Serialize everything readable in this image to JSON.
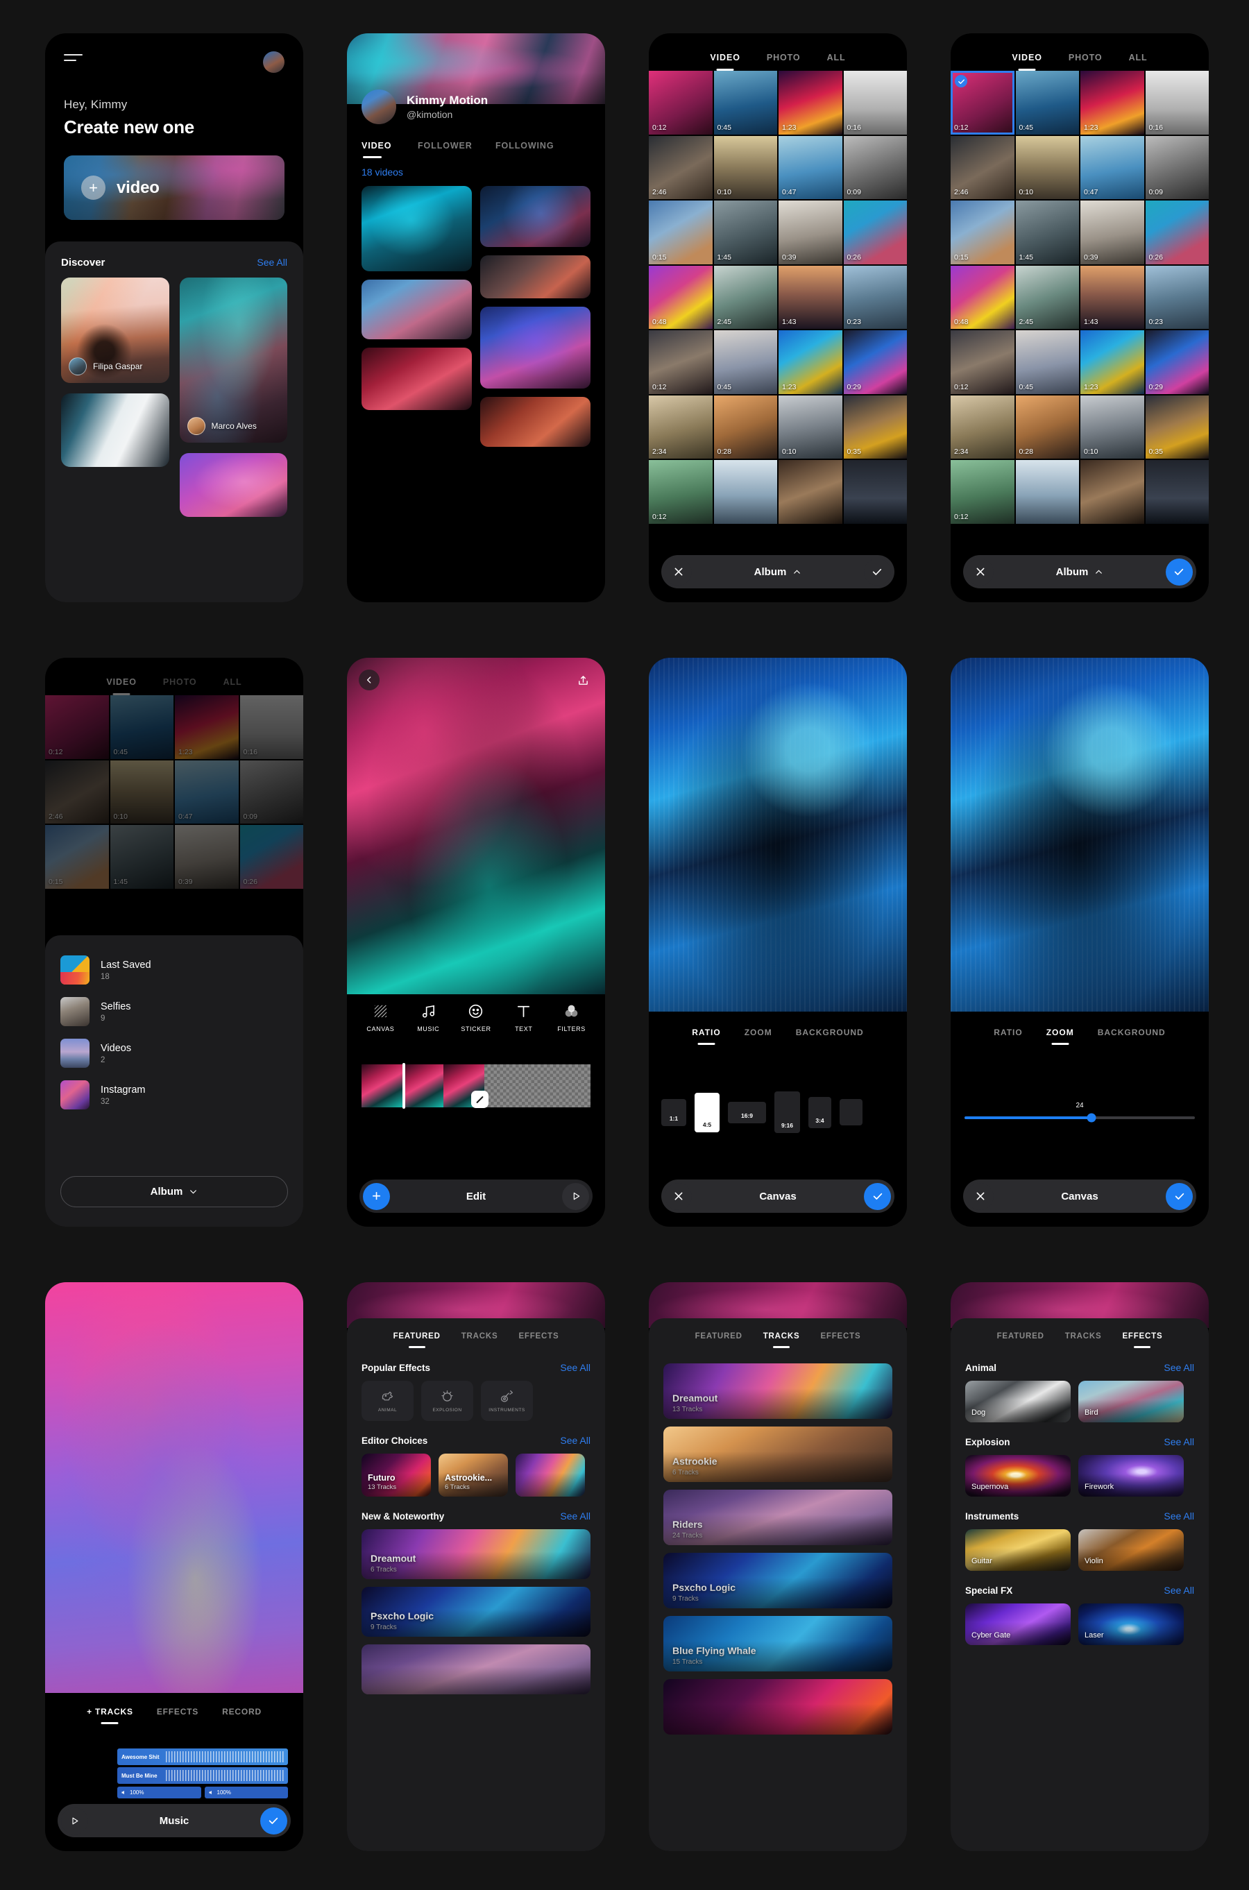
{
  "home": {
    "greeting": "Hey, Kimmy",
    "title": "Create new one",
    "hero_label": "video",
    "discover": {
      "title": "Discover",
      "see_all": "See All"
    },
    "discover_cards": [
      {
        "author": "Filipa Gaspar"
      },
      {
        "author": "Marco Alves"
      }
    ]
  },
  "profile": {
    "name": "Kimmy Motion",
    "handle": "@kimotion",
    "tabs": [
      {
        "label": "VIDEO",
        "active": true
      },
      {
        "label": "FOLLOWER",
        "active": false
      },
      {
        "label": "FOLLOWING",
        "active": false
      }
    ],
    "video_count": "18 videos"
  },
  "gallery": {
    "tabs": [
      {
        "label": "VIDEO",
        "active": true
      },
      {
        "label": "PHOTO",
        "active": false
      },
      {
        "label": "ALL",
        "active": false
      }
    ],
    "durations": [
      "0:12",
      "0:45",
      "1:23",
      "0:16",
      "2:46",
      "0:10",
      "0:47",
      "0:09",
      "0:15",
      "1:45",
      "0:39",
      "0:26",
      "0:48",
      "2:45",
      "1:43",
      "0:23",
      "0:12",
      "0:45",
      "1:23",
      "0:29",
      "2:34",
      "0:28",
      "0:10",
      "0:35",
      "0:12",
      "",
      "",
      ""
    ],
    "bottom_bar": {
      "close_icon": "close-icon",
      "label": "Album",
      "chevron": "chevron-up-icon",
      "confirm_icon": "check-icon"
    }
  },
  "albums": {
    "tabs": [
      {
        "label": "VIDEO",
        "active": true
      },
      {
        "label": "PHOTO",
        "active": false
      },
      {
        "label": "ALL",
        "active": false
      }
    ],
    "items": [
      {
        "name": "Last Saved",
        "count": "18"
      },
      {
        "name": "Selfies",
        "count": "9"
      },
      {
        "name": "Videos",
        "count": "2"
      },
      {
        "name": "Instagram",
        "count": "32"
      }
    ],
    "button_label": "Album"
  },
  "editor": {
    "tools": [
      {
        "label": "CANVAS",
        "icon": "canvas-icon"
      },
      {
        "label": "MUSIC",
        "icon": "music-note-icon"
      },
      {
        "label": "STICKER",
        "icon": "smiley-icon"
      },
      {
        "label": "TEXT",
        "icon": "text-t-icon"
      },
      {
        "label": "FILTERS",
        "icon": "filters-circles-icon"
      }
    ],
    "bottom_bar": {
      "add_icon": "plus-icon",
      "label": "Edit",
      "play_icon": "play-icon"
    }
  },
  "canvas_ratio": {
    "tabs": [
      {
        "label": "RATIO",
        "active": true
      },
      {
        "label": "ZOOM",
        "active": false
      },
      {
        "label": "BACKGROUND",
        "active": false
      }
    ],
    "ratios": [
      {
        "label": "1:1",
        "selected": false
      },
      {
        "label": "4:5",
        "selected": true
      },
      {
        "label": "16:9",
        "selected": false
      },
      {
        "label": "9:16",
        "selected": false
      },
      {
        "label": "3:4",
        "selected": false
      }
    ],
    "bottom_bar": {
      "label": "Canvas"
    }
  },
  "canvas_zoom": {
    "tabs": [
      {
        "label": "RATIO",
        "active": false
      },
      {
        "label": "ZOOM",
        "active": true
      },
      {
        "label": "BACKGROUND",
        "active": false
      }
    ],
    "zoom_value": "24",
    "bottom_bar": {
      "label": "Canvas"
    }
  },
  "music": {
    "tabs": [
      {
        "label": "+ TRACKS",
        "active": true
      },
      {
        "label": "EFFECTS",
        "active": false
      },
      {
        "label": "RECORD",
        "active": false
      }
    ],
    "clips": [
      {
        "title": "Awesome Shit"
      },
      {
        "title": "Must Be Mine"
      }
    ],
    "volumes": [
      "100%",
      "100%"
    ],
    "bottom_bar": {
      "label": "Music"
    }
  },
  "store_featured": {
    "tabs": [
      {
        "label": "FEATURED",
        "active": true
      },
      {
        "label": "TRACKS",
        "active": false
      },
      {
        "label": "EFFECTS",
        "active": false
      }
    ],
    "sections": [
      {
        "title": "Popular Effects",
        "see_all": "See All",
        "chips": [
          {
            "label": "ANIMAL",
            "icon": "animal-icon"
          },
          {
            "label": "EXPLOSION",
            "icon": "explosion-icon"
          },
          {
            "label": "INSTRUMENTS",
            "icon": "instrument-icon"
          }
        ]
      },
      {
        "title": "Editor Choices",
        "see_all": "See All",
        "cards": [
          {
            "title": "Futuro",
            "sub": "13 Tracks"
          },
          {
            "title": "Astrookie...",
            "sub": "6 Tracks"
          }
        ]
      },
      {
        "title": "New & Noteworthy",
        "see_all": "See All",
        "cards": [
          {
            "title": "Dreamout",
            "sub": "6 Tracks"
          },
          {
            "title": "Psxcho Logic",
            "sub": "9 Tracks"
          }
        ]
      }
    ]
  },
  "store_tracks": {
    "tabs": [
      {
        "label": "FEATURED",
        "active": false
      },
      {
        "label": "TRACKS",
        "active": true
      },
      {
        "label": "EFFECTS",
        "active": false
      }
    ],
    "items": [
      {
        "title": "Dreamout",
        "sub": "13 Tracks"
      },
      {
        "title": "Astrookie",
        "sub": "6 Tracks"
      },
      {
        "title": "Riders",
        "sub": "24 Tracks"
      },
      {
        "title": "Psxcho Logic",
        "sub": "9 Tracks"
      },
      {
        "title": "Blue Flying Whale",
        "sub": "15 Tracks"
      }
    ]
  },
  "store_effects": {
    "tabs": [
      {
        "label": "FEATURED",
        "active": false
      },
      {
        "label": "TRACKS",
        "active": false
      },
      {
        "label": "EFFECTS",
        "active": true
      }
    ],
    "sections": [
      {
        "title": "Animal",
        "see_all": "See All",
        "cards": [
          {
            "title": "Dog"
          },
          {
            "title": "Bird"
          }
        ]
      },
      {
        "title": "Explosion",
        "see_all": "See All",
        "cards": [
          {
            "title": "Supernova"
          },
          {
            "title": "Firework"
          }
        ]
      },
      {
        "title": "Instruments",
        "see_all": "See All",
        "cards": [
          {
            "title": "Guitar"
          },
          {
            "title": "Violin"
          }
        ]
      },
      {
        "title": "Special FX",
        "see_all": "See All",
        "cards": [
          {
            "title": "Cyber Gate"
          },
          {
            "title": "Laser"
          }
        ]
      }
    ]
  },
  "colors": {
    "accent": "#1d7ef3",
    "link": "#2f7ef0",
    "background": "#141414",
    "surface": "#1c1c1e"
  }
}
